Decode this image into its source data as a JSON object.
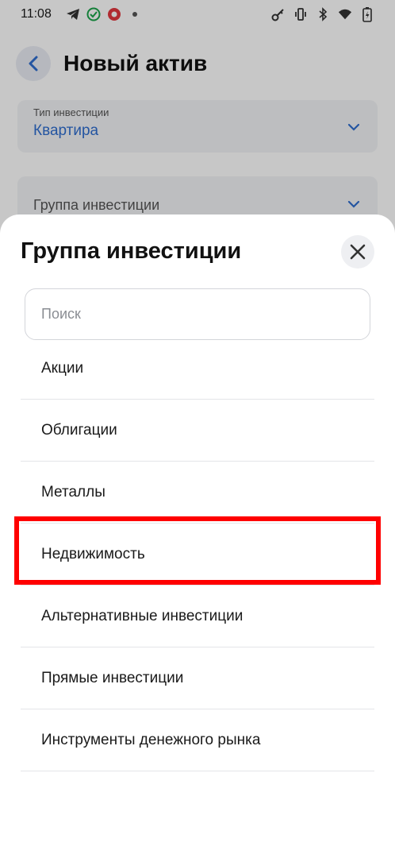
{
  "status": {
    "time": "11:08"
  },
  "header": {
    "title": "Новый актив"
  },
  "form": {
    "type_label": "Тип инвестиции",
    "type_value": "Квартира",
    "group_label": "Группа инвестиции"
  },
  "sheet": {
    "title": "Группа инвестиции",
    "search_placeholder": "Поиск",
    "items": [
      {
        "label": "Акции"
      },
      {
        "label": "Облигации"
      },
      {
        "label": "Металлы"
      },
      {
        "label": "Недвижимость"
      },
      {
        "label": "Альтернативные инвестиции"
      },
      {
        "label": "Прямые инвестиции"
      },
      {
        "label": "Инструменты денежного рынка"
      }
    ]
  },
  "colors": {
    "accent": "#2f6ecf",
    "highlight": "#ff0000"
  },
  "icons": [
    "back-arrow-icon",
    "chevron-down-icon",
    "close-icon",
    "telegram-icon",
    "check-icon",
    "app-icon",
    "key-icon",
    "vibrate-icon",
    "bluetooth-icon",
    "wifi-icon",
    "battery-icon"
  ]
}
